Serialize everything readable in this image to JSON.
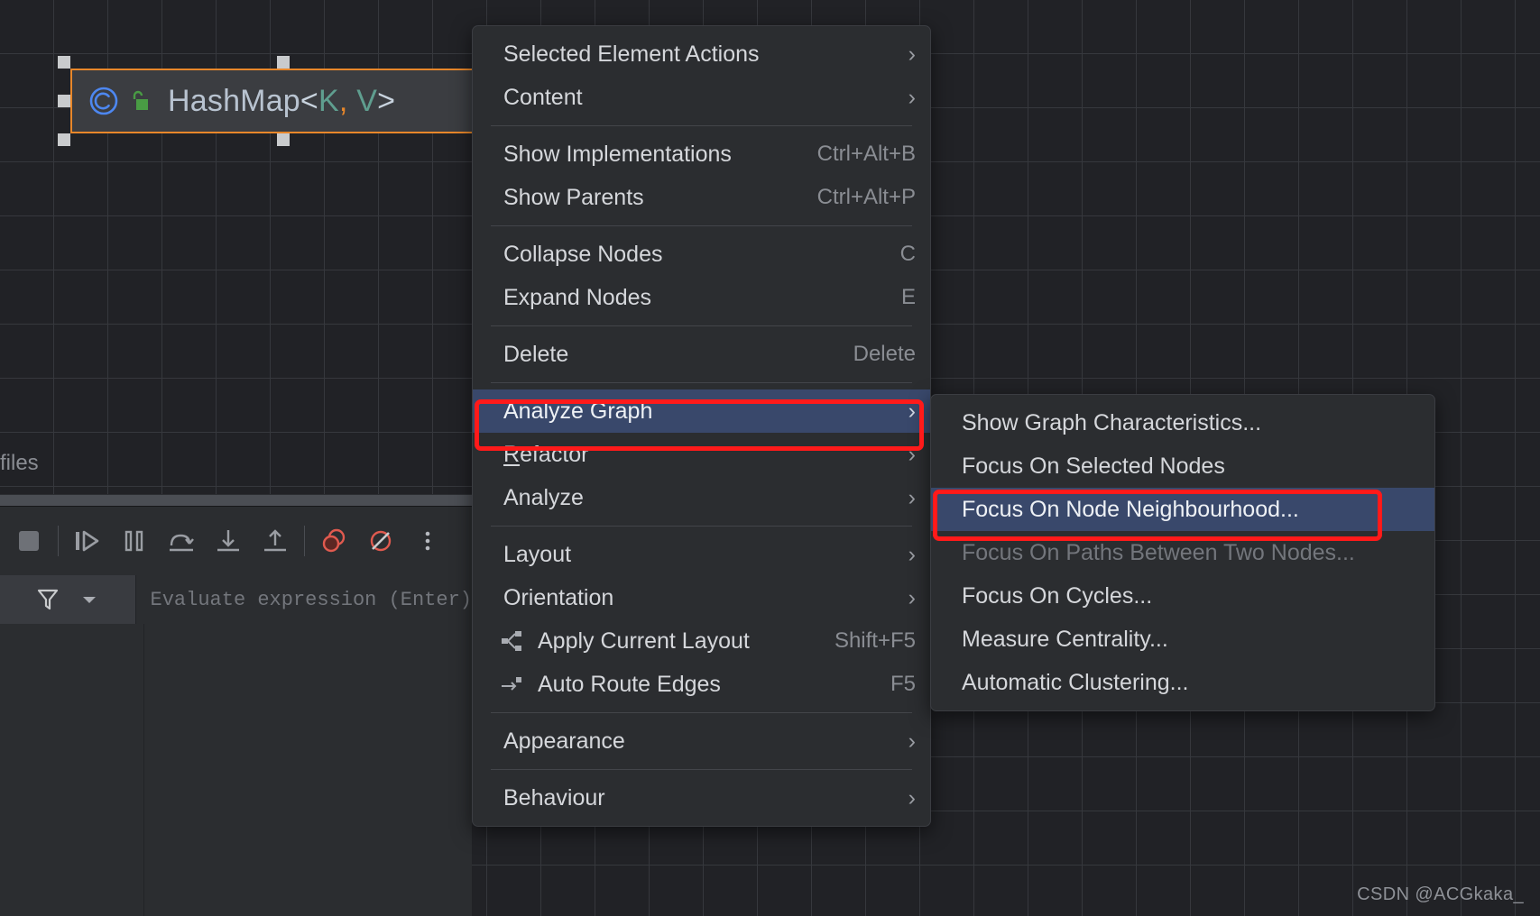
{
  "canvas": {
    "files_label": "files",
    "node": {
      "name": "HashMap",
      "generic_open": "<",
      "type_param_k": "K",
      "comma": ",",
      "type_param_v": "V",
      "generic_close": ">",
      "full_label": "HashMap<K, V>",
      "class_icon": "class-circle-c-icon",
      "visibility_icon": "unlocked-padlock-icon",
      "border_color": "#e8872a",
      "fill_color": "#3b3d41"
    }
  },
  "context_menu": {
    "name": "diagram-context-menu",
    "items": [
      {
        "label": "Selected Element Actions",
        "shortcut": "",
        "arrow": "›",
        "state": "normal",
        "icon": ""
      },
      {
        "label": "Content",
        "shortcut": "",
        "arrow": "›",
        "state": "normal",
        "icon": ""
      },
      {
        "separator": true
      },
      {
        "label": "Show Implementations",
        "shortcut": "Ctrl+Alt+B",
        "arrow": "",
        "state": "normal",
        "icon": ""
      },
      {
        "label": "Show Parents",
        "shortcut": "Ctrl+Alt+P",
        "arrow": "",
        "state": "normal",
        "icon": ""
      },
      {
        "separator": true
      },
      {
        "label": "Collapse Nodes",
        "shortcut": "C",
        "arrow": "",
        "state": "normal",
        "icon": ""
      },
      {
        "label": "Expand Nodes",
        "shortcut": "E",
        "arrow": "",
        "state": "normal",
        "icon": ""
      },
      {
        "separator": true
      },
      {
        "label": "Delete",
        "shortcut": "Delete",
        "arrow": "",
        "state": "normal",
        "icon": ""
      },
      {
        "separator": true
      },
      {
        "label": "Analyze Graph",
        "shortcut": "",
        "arrow": "›",
        "state": "selected",
        "icon": ""
      },
      {
        "label": "Refactor",
        "shortcut": "",
        "arrow": "›",
        "state": "normal",
        "icon": "",
        "mnemonic": "R"
      },
      {
        "label": "Analyze",
        "shortcut": "",
        "arrow": "›",
        "state": "normal",
        "icon": ""
      },
      {
        "separator": true
      },
      {
        "label": "Layout",
        "shortcut": "",
        "arrow": "›",
        "state": "normal",
        "icon": ""
      },
      {
        "label": "Orientation",
        "shortcut": "",
        "arrow": "›",
        "state": "normal",
        "icon": ""
      },
      {
        "label": "Apply Current Layout",
        "shortcut": "Shift+F5",
        "arrow": "",
        "state": "normal",
        "icon": "layout-tree-icon"
      },
      {
        "label": "Auto Route Edges",
        "shortcut": "F5",
        "arrow": "",
        "state": "normal",
        "icon": "route-arrow-icon"
      },
      {
        "separator": true
      },
      {
        "label": "Appearance",
        "shortcut": "",
        "arrow": "›",
        "state": "normal",
        "icon": ""
      },
      {
        "separator": true
      },
      {
        "label": "Behaviour",
        "shortcut": "",
        "arrow": "›",
        "state": "normal",
        "icon": ""
      }
    ]
  },
  "sub_menu": {
    "name": "analyze-graph-submenu",
    "items": [
      {
        "label": "Show Graph Characteristics...",
        "state": "normal"
      },
      {
        "label": "Focus On Selected Nodes",
        "state": "normal"
      },
      {
        "label": "Focus On Node Neighbourhood...",
        "state": "selected"
      },
      {
        "label": "Focus On Paths Between Two Nodes...",
        "state": "disabled"
      },
      {
        "label": "Focus On Cycles...",
        "state": "normal"
      },
      {
        "label": "Measure Centrality...",
        "state": "normal"
      },
      {
        "label": "Automatic Clustering...",
        "state": "normal"
      }
    ]
  },
  "debugger": {
    "toolbar": [
      {
        "name": "stop-button",
        "icon": "stop-square-icon"
      },
      {
        "name": "resume-button",
        "icon": "resume-program-icon"
      },
      {
        "name": "pause-button",
        "icon": "pause-program-icon"
      },
      {
        "name": "step-over-button",
        "icon": "step-over-icon"
      },
      {
        "name": "step-into-button",
        "icon": "step-into-icon"
      },
      {
        "name": "step-out-button",
        "icon": "step-out-icon"
      },
      {
        "name": "view-breakpoints-button",
        "icon": "breakpoints-icon"
      },
      {
        "name": "mute-breakpoints-button",
        "icon": "mute-breakpoints-icon"
      },
      {
        "name": "more-options-button",
        "icon": "more-vertical-icon"
      }
    ],
    "filter_icon": "filter-funnel-icon",
    "dropdown_icon": "chevron-down-icon",
    "evaluate_placeholder": "Evaluate expression (Enter)"
  },
  "watermark": "CSDN @ACGkaka_",
  "colors": {
    "accent_selection": "#39486b",
    "annotation_red": "#ff1a1a",
    "node_border_orange": "#e8872a",
    "menu_bg": "#2b2d30",
    "canvas_bg": "#212226"
  }
}
